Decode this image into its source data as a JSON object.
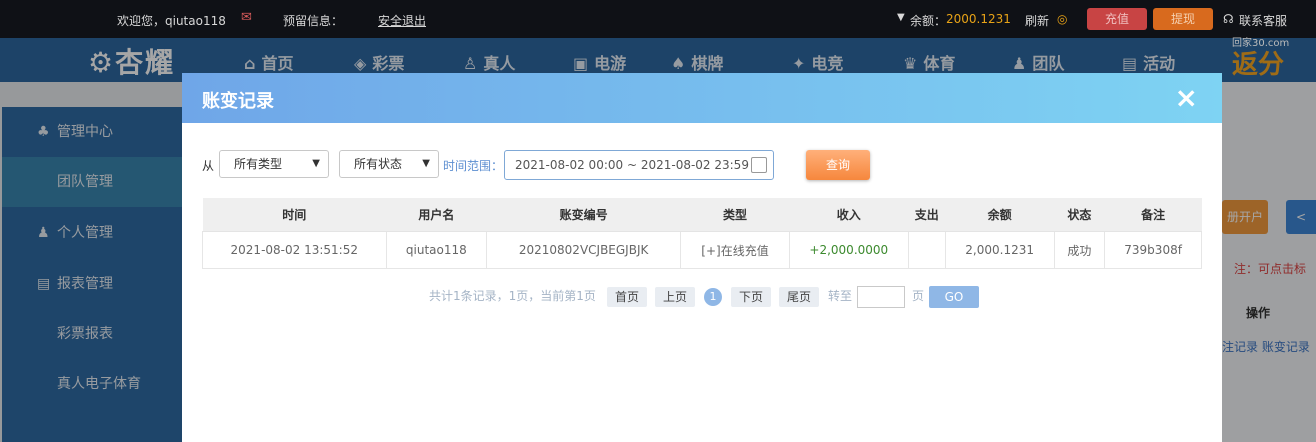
{
  "topbar": {
    "welcome": "欢迎您，qiutao118",
    "reserved_label": "预留信息：",
    "logout": "安全退出",
    "balance_label": "余额：",
    "balance_value": "2000.1231",
    "refresh": "刷新",
    "deposit": "充值",
    "withdraw": "提现",
    "support": "联系客服",
    "watermark": "回家30.com"
  },
  "nav": {
    "logo": "杏耀",
    "items": [
      "首页",
      "彩票",
      "真人",
      "电游",
      "棋牌",
      "电竞",
      "体育",
      "团队",
      "活动"
    ],
    "right_text": "返分"
  },
  "sidebar": {
    "items": [
      "管理中心",
      "团队管理",
      "个人管理",
      "报表管理",
      "彩票报表",
      "真人电子体育"
    ]
  },
  "background_right": {
    "open_account": "册开户",
    "note": "注：可点击标",
    "operation": "操作",
    "links": "注记录  账变记录"
  },
  "modal": {
    "title": "账变记录",
    "close": "×",
    "from_label": "从",
    "type_select": "所有类型",
    "status_select": "所有状态",
    "time_range_label": "时间范围：",
    "date_range": "2021-08-02 00:00 ~ 2021-08-02 23:59",
    "query_button": "查询",
    "table": {
      "headers": [
        "时间",
        "用户名",
        "账变编号",
        "类型",
        "收入",
        "支出",
        "余额",
        "状态",
        "备注"
      ],
      "rows": [
        [
          "2021-08-02 13:51:52",
          "qiutao118",
          "20210802VCJBEGJBJK",
          "[+]在线充值",
          "+2,000.0000",
          "",
          "2,000.1231",
          "成功",
          "739b308f"
        ]
      ]
    },
    "pager": {
      "summary": "共计1条记录，1页，当前第1页",
      "first": "首页",
      "prev": "上页",
      "current": "1",
      "next": "下页",
      "last": "尾页",
      "goto_label": "转至",
      "page_unit": "页",
      "go": "GO"
    }
  },
  "colors": {
    "modal_header_start": "#6fa6e8",
    "modal_header_end": "#7ed3f3",
    "income": "#3c8a2e",
    "balance": "#e8a317",
    "query_button": "#f6873d"
  }
}
